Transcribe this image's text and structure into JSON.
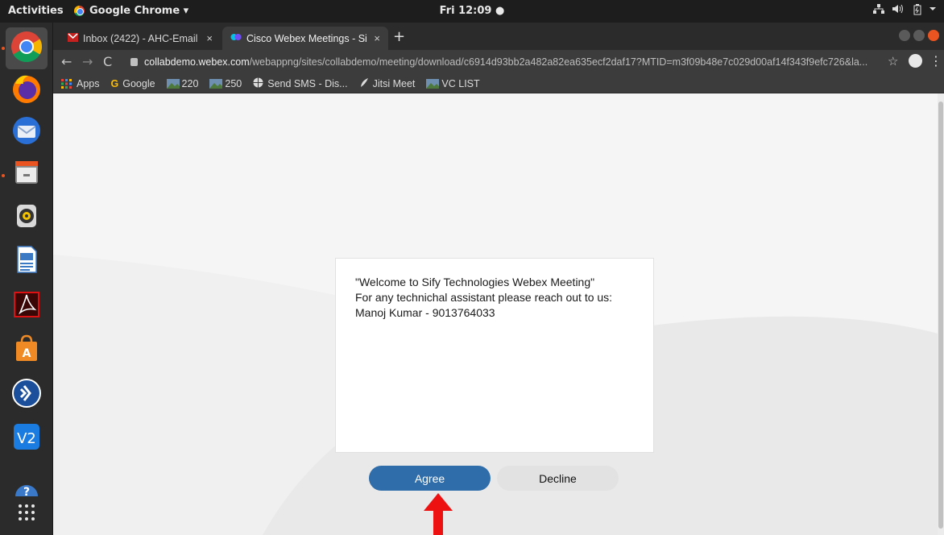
{
  "topbar": {
    "activities": "Activities",
    "app_name": "Google Chrome ▾",
    "clock": "Fri 12:09 ●",
    "status_icons": [
      "network-icon",
      "volume-icon",
      "battery-icon",
      "system-menu-icon"
    ]
  },
  "dock": {
    "apps": [
      "chrome-icon",
      "firefox-icon",
      "thunderbird-icon",
      "files-icon",
      "rhythmbox-icon",
      "libreoffice-writer-icon",
      "acrobat-reader-icon",
      "software-center-icon",
      "anydesk-icon",
      "vnc-viewer-icon",
      "help-icon",
      "show-applications-icon"
    ]
  },
  "browser": {
    "tabs": [
      {
        "label": "Inbox (2422) - AHC-Email",
        "close": "×"
      },
      {
        "label": "Cisco Webex Meetings - Si",
        "close": "×"
      }
    ],
    "new_tab": "+",
    "url_host": "collabdemo.webex.com",
    "url_path": "/webappng/sites/collabdemo/meeting/download/c6914d93bb2a482a82ea635ecf2daf17?MTID=m3f09b48e7c029d00af14f343f9efc726&la...",
    "bookmarks": [
      "Apps",
      "Google",
      "220",
      "250",
      "Send SMS - Dis...",
      "Jitsi Meet",
      "VC LIST"
    ]
  },
  "dialog": {
    "line1": "\"Welcome to Sify Technologies Webex Meeting\"",
    "line2": "For any technichal assistant please reach out to us:",
    "line3": "Manoj Kumar - 9013764033"
  },
  "buttons": {
    "agree": "Agree",
    "decline": "Decline"
  },
  "colors": {
    "accent": "#2e6daa",
    "arrow": "#ee1111",
    "ubuntu_orange": "#e95420"
  }
}
